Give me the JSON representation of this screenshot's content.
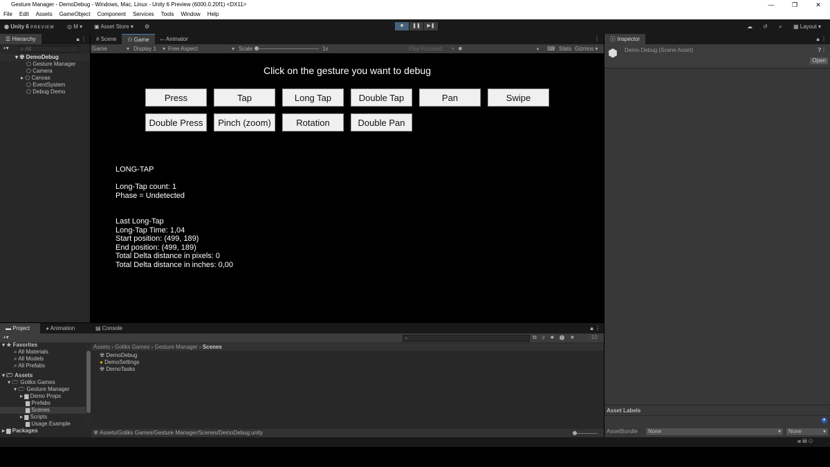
{
  "window": {
    "title": "Gesture Manager - DemoDebug - Windows, Mac, Linux - Unity 6 Preview (6000.0.20f1) <DX11>",
    "controls": [
      "—",
      "❐",
      "✕"
    ]
  },
  "menu": [
    "File",
    "Edit",
    "Assets",
    "GameObject",
    "Component",
    "Services",
    "Tools",
    "Window",
    "Help"
  ],
  "toolbar": {
    "brand": "Unity 6",
    "preview": "PREVIEW",
    "account": "M",
    "asset_store": "Asset Store",
    "layout": "Layout"
  },
  "hierarchy": {
    "tab": "Hierarchy",
    "search_placeholder": "All",
    "scene": "DemoDebug",
    "items": [
      "Gesture Manager",
      "Camera",
      "Canvas",
      "EventSystem",
      "Debug Demo"
    ]
  },
  "game_view": {
    "tabs": [
      "Scene",
      "Game",
      "Animator"
    ],
    "view": "Game",
    "display": "Display 1",
    "aspect": "Free Aspect",
    "scale_label": "Scale",
    "scale": "1x",
    "play_mode": "Play Focused",
    "stats": "Stats",
    "gizmos": "Gizmos"
  },
  "game": {
    "heading": "Click on the gesture you want to debug",
    "buttons": [
      "Press",
      "Tap",
      "Long Tap",
      "Double Tap",
      "Pan",
      "Swipe",
      "Double Press",
      "Pinch (zoom)",
      "Rotation",
      "Double Pan"
    ],
    "info": [
      "LONG-TAP",
      "",
      "Long-Tap count: 1",
      "Phase = Undetected",
      "",
      "",
      "Last Long-Tap",
      "Long-Tap Time: 1,04",
      "Start position: (499, 189)",
      "End position: (499, 189)",
      "Total Delta distance in pixels: 0",
      "Total Delta distance in inches: 0,00"
    ]
  },
  "inspector": {
    "tab": "Inspector",
    "title": "Demo Debug (Scene Asset)",
    "open": "Open",
    "asset_labels": "Asset Labels",
    "asset_bundle_label": "AssetBundle",
    "asset_bundle": "None",
    "variant": "None"
  },
  "project": {
    "tabs": [
      "Project",
      "Animation",
      "Console"
    ],
    "favorites": {
      "label": "Favorites",
      "items": [
        "All Materials",
        "All Models",
        "All Prefabs"
      ]
    },
    "assets": {
      "label": "Assets",
      "golike": "Goliks Games",
      "gm": "Gesture Manager",
      "folders": [
        "Demo Props",
        "Prefabs",
        "Scenes",
        "Scripts",
        "Usage Example"
      ],
      "packages": "Packages"
    },
    "breadcrumb": [
      "Assets",
      "Goliks Games",
      "Gesture Manager",
      "Scenes"
    ],
    "files": [
      "DemoDebug",
      "DemoSettings",
      "DemoTasks"
    ],
    "hidden_count": "10",
    "path": "Assets/Goliks Games/Gesture Manager/Scenes/DemoDebug.unity"
  }
}
